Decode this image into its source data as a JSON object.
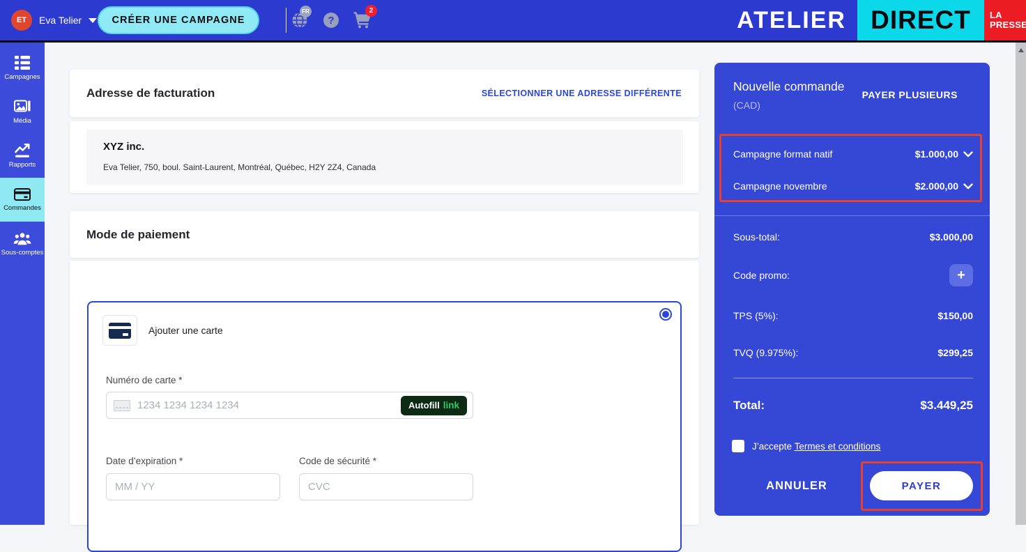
{
  "header": {
    "user": {
      "initials": "ET",
      "name": "Eva Telier"
    },
    "create_campaign_label": "CRÉER UNE CAMPAGNE",
    "language_badge": "FR",
    "help_glyph": "?",
    "cart_count": "2",
    "logo": {
      "atelier": "ATELIER",
      "direct": "DIRECT",
      "la": "LA",
      "presse": "PRESSE"
    }
  },
  "sidebar": {
    "items": [
      {
        "label": "Campagnes",
        "icon": "campaigns-grid-icon",
        "active": false
      },
      {
        "label": "Média",
        "icon": "media-image-icon",
        "active": false
      },
      {
        "label": "Rapports",
        "icon": "reports-chart-icon",
        "active": false
      },
      {
        "label": "Commandes",
        "icon": "orders-card-icon",
        "active": true
      },
      {
        "label": "Sous-comptes",
        "icon": "subaccounts-people-icon",
        "active": false
      }
    ]
  },
  "billing": {
    "title": "Adresse de facturation",
    "change_address_link": "SÉLECTIONNER UNE ADRESSE DIFFÉRENTE",
    "company": "XYZ inc.",
    "address": "Eva Telier, 750, boul. Saint-Laurent, Montréal, Québec, H2Y 2Z4, Canada"
  },
  "payment": {
    "title": "Mode de paiement",
    "add_card_label": "Ajouter une carte",
    "card_number_label": "Numéro de carte *",
    "card_number_placeholder": "1234 1234 1234 1234",
    "autofill_label": "Autofill",
    "autofill_brand": "link",
    "expiry_label": "Date d’expiration *",
    "expiry_placeholder": "MM / YY",
    "cvc_label": "Code de sécurité *",
    "cvc_placeholder": "CVC"
  },
  "order": {
    "title": "Nouvelle commande",
    "currency": "(CAD)",
    "pay_multiple_label": "PAYER PLUSIEURS",
    "items": [
      {
        "name": "Campagne format natif",
        "amount": "$1.000,00"
      },
      {
        "name": "Campagne novembre",
        "amount": "$2.000,00"
      }
    ],
    "subtotal_label": "Sous-total:",
    "subtotal_value": "$3.000,00",
    "promo_label": "Code promo:",
    "promo_add_glyph": "+",
    "tps_label": "TPS (5%):",
    "tps_value": "$150,00",
    "tvq_label": "TVQ (9.975%):",
    "tvq_value": "$299,25",
    "total_label": "Total:",
    "total_value": "$3.449,25",
    "terms_prefix": "J’accepte",
    "terms_link": "Termes et conditions",
    "cancel_label": "ANNULER",
    "pay_label": "PAYER"
  },
  "colors": {
    "header_blue": "#2c3ad0",
    "sidebar_blue": "#3c4bda",
    "panel_blue": "#3547d5",
    "selected_cyan": "#8ee9f3",
    "brand_cyan": "#0bd9e9",
    "brand_red": "#ec1c24",
    "accent_link_blue": "#2b46d8",
    "annotation_red": "#e8402e",
    "autofill_green": "#35c768",
    "avatar_red": "#e0462e",
    "cart_badge_red": "#f2202e"
  }
}
